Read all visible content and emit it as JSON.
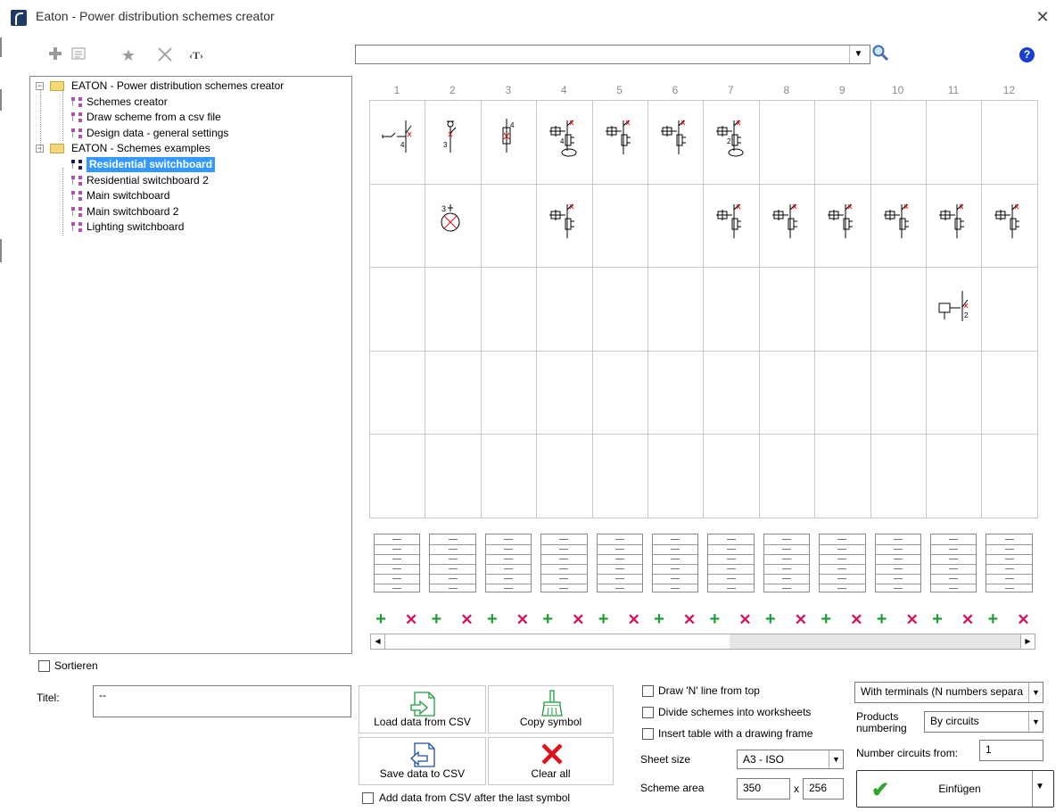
{
  "window": {
    "title": "Eaton - Power distribution schemes creator",
    "close_glyph": "✕"
  },
  "toolbar": {
    "icons": [
      "add-icon",
      "properties-icon",
      "star-icon",
      "delete-icon",
      "text-icon"
    ],
    "text_glyph": "‹T›"
  },
  "search": {
    "value": "",
    "dropdown_glyph": "▼",
    "help_glyph": "?"
  },
  "tree": {
    "items": [
      {
        "label": "EATON - Power distribution schemes creator",
        "type": "folder",
        "level": 0
      },
      {
        "label": "Schemes creator",
        "type": "node",
        "level": 1
      },
      {
        "label": "Draw scheme from a csv file",
        "type": "node",
        "level": 1
      },
      {
        "label": "Design data - general settings",
        "type": "node",
        "level": 1
      },
      {
        "label": "EATON - Schemes examples",
        "type": "folder",
        "level": 0
      },
      {
        "label": "Residential switchboard",
        "type": "node",
        "level": 1,
        "selected": true
      },
      {
        "label": "Residential switchboard 2",
        "type": "node",
        "level": 1
      },
      {
        "label": "Main switchboard",
        "type": "node",
        "level": 1
      },
      {
        "label": "Main switchboard 2",
        "type": "node",
        "level": 1
      },
      {
        "label": "Lighting switchboard",
        "type": "node",
        "level": 1
      }
    ],
    "expander_glyph": "−"
  },
  "grid": {
    "columns": [
      "1",
      "2",
      "3",
      "4",
      "5",
      "6",
      "7",
      "8",
      "9",
      "10",
      "11",
      "12"
    ],
    "rows": [
      [
        "switch-disconnector",
        "switch-lamp",
        "fuse-switch",
        "rcbo-coil",
        "rcbo",
        "rcbo",
        "rcbo-coil",
        "",
        "",
        "",
        "",
        ""
      ],
      [
        "",
        "indicator-lamp",
        "",
        "rcbo",
        "",
        "",
        "rcbo",
        "rcbo",
        "rcbo",
        "rcbo",
        "rcbo",
        "rcbo"
      ],
      [
        "",
        "",
        "",
        "",
        "",
        "",
        "",
        "",
        "",
        "",
        "contactor",
        ""
      ],
      [
        "",
        "",
        "",
        "",
        "",
        "",
        "",
        "",
        "",
        "",
        "",
        ""
      ],
      [
        "",
        "",
        "",
        "",
        "",
        "",
        "",
        "",
        "",
        "",
        "",
        ""
      ]
    ],
    "symbol_labels": {
      "switch-disconnector": "4",
      "switch-lamp": "3",
      "fuse-switch": "4",
      "rcbo-coil": "4",
      "rcbo-coil-7": "2",
      "indicator-lamp": "3",
      "contactor": "2"
    },
    "add_glyph": "+",
    "remove_glyph": "✕"
  },
  "scrollbar": {
    "left_glyph": "◀",
    "right_glyph": "▶"
  },
  "sort": {
    "label": "Sortieren",
    "checked": false
  },
  "title_field": {
    "label": "Titel:",
    "value": "--"
  },
  "buttons": {
    "load_csv": "Load data from CSV",
    "copy_symbol": "Copy symbol",
    "save_csv": "Save data to CSV",
    "clear_all": "Clear all"
  },
  "options": {
    "draw_n_line": "Draw 'N' line from top",
    "divide_schemes": "Divide schemes into worksheets",
    "insert_table": "Insert table with a drawing frame",
    "add_after_last": "Add data from CSV after the last symbol"
  },
  "sheet": {
    "size_label": "Sheet size",
    "size_value": "A3 - ISO",
    "area_label": "Scheme area",
    "area_width": "350",
    "area_sep": "x",
    "area_height": "256"
  },
  "right_panel": {
    "terminals_value": "With terminals (N numbers separa",
    "products_numbering_label_1": "Products",
    "products_numbering_label_2": "numbering",
    "numbering_value": "By circuits",
    "number_from_label": "Number circuits from:",
    "number_from_value": "1",
    "insert_label": "Einfügen",
    "check_glyph": "✔"
  }
}
